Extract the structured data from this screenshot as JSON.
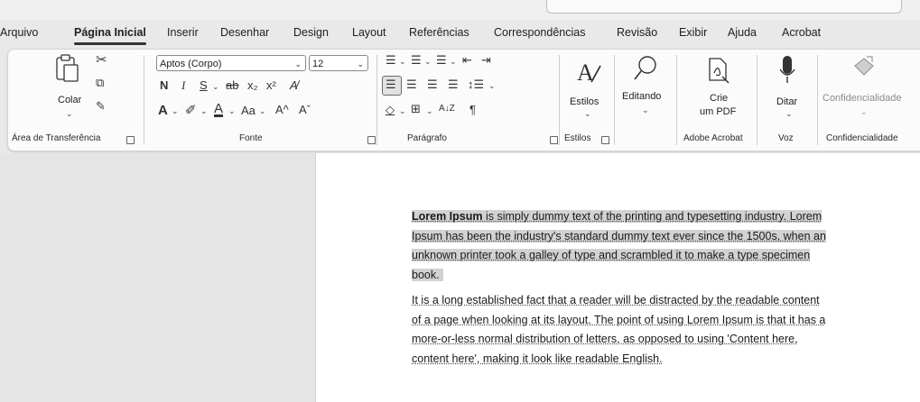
{
  "tabs": [
    "Arquivo",
    "Página Inicial",
    "Inserir",
    "Desenhar",
    "Design",
    "Layout",
    "Referências",
    "Correspondências",
    "Revisão",
    "Exibir",
    "Ajuda",
    "Acrobat"
  ],
  "active_tab": "Página Inicial",
  "clipboard": {
    "paste_label": "Colar",
    "group_label": "Área de Transferência"
  },
  "font": {
    "name": "Aptos (Corpo)",
    "size": "12",
    "group_label": "Fonte",
    "bold": "N",
    "italic": "I",
    "underline": "S",
    "subscript": "x₂",
    "superscript": "x²",
    "case": "Aa",
    "grow": "A^",
    "shrink": "Aˇ"
  },
  "paragraph": {
    "group_label": "Parágrafo",
    "sort": "A↓Z",
    "pilcrow": "¶"
  },
  "styles": {
    "label": "Estilos",
    "group_label": "Estilos"
  },
  "editing": {
    "label": "Editando"
  },
  "acrobat": {
    "label_line1": "Crie",
    "label_line2": "um PDF",
    "group_label": "Adobe Acrobat"
  },
  "voice": {
    "label": "Ditar",
    "group_label": "Voz"
  },
  "sensitivity": {
    "label": "Confidencialidade",
    "group_label": "Confidencialidade"
  },
  "document": {
    "p1_line1_bold": "Lorem Ipsum",
    "p1_line1_rest": " is simply dummy text of the printing and typesetting industry. Lorem",
    "p1_line2": "Ipsum has been the industry's standard dummy text ever since the 1500s, when an",
    "p1_line3": "unknown printer took a galley of type and scrambled it to make a type specimen",
    "p1_line4": "book.",
    "p2_line1": "It is a long established fact that a reader will be distracted by the readable content",
    "p2_line2": "of a page when looking at its layout. The point of using Lorem Ipsum is that it has a",
    "p2_line3": "more-or-less normal distribution of letters, as opposed to using 'Content here,",
    "p2_line4": "content here', making it look like readable English."
  }
}
